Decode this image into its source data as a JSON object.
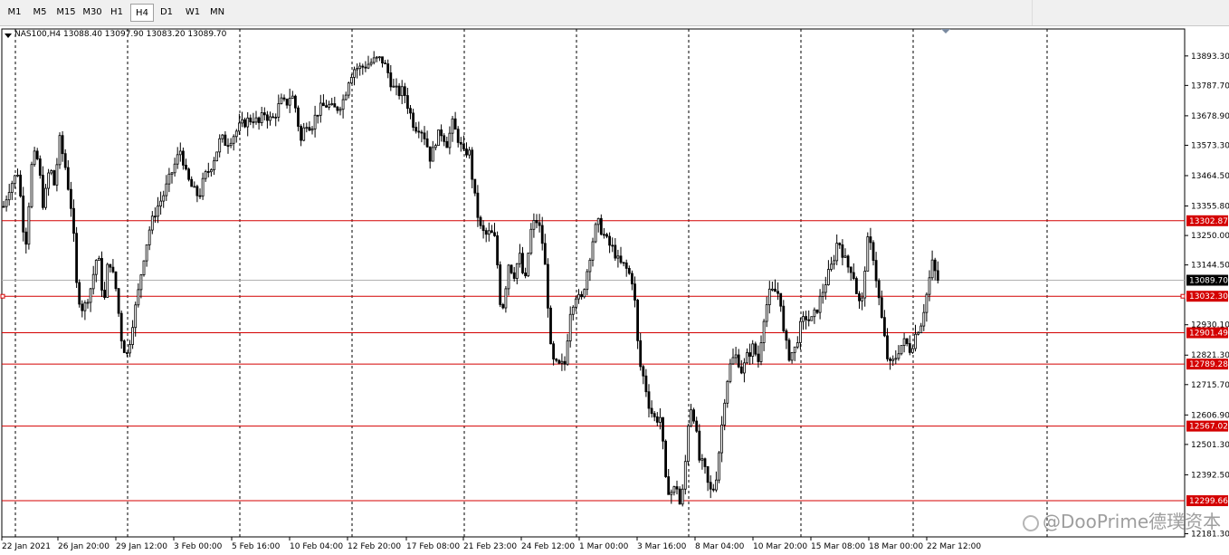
{
  "toolbar": {
    "timeframes": [
      {
        "label": "M1",
        "active": false
      },
      {
        "label": "M5",
        "active": false
      },
      {
        "label": "M15",
        "active": false
      },
      {
        "label": "M30",
        "active": false
      },
      {
        "label": "H1",
        "active": false
      },
      {
        "label": "H4",
        "active": true
      },
      {
        "label": "D1",
        "active": false
      },
      {
        "label": "W1",
        "active": false
      },
      {
        "label": "MN",
        "active": false
      }
    ]
  },
  "symbol_info": "NAS100,H4  13088.40 13097.90 13083.20 13089.70",
  "watermark": {
    "text": "@DooPrime德璞资本",
    "icon": "wechat-icon"
  },
  "colors": {
    "level_line": "#d40000",
    "candle": "#000000",
    "grid": "#000000",
    "current_price_bg": "#000000"
  },
  "chart_data": {
    "type": "candlestick",
    "symbol": "NAS100",
    "timeframe": "H4",
    "ohlc_header": {
      "open": 13088.4,
      "high": 13097.9,
      "low": 13083.2,
      "close": 13089.7
    },
    "y_ticks": [
      13893.3,
      13787.7,
      13678.9,
      13573.3,
      13464.5,
      13355.8,
      13250.0,
      13144.5,
      12930.1,
      12821.3,
      12715.7,
      12606.9,
      12501.3,
      12392.5,
      12181.3
    ],
    "ylim": [
      12170.0,
      13990.0
    ],
    "x_ticks": [
      "22 Jan 2021",
      "26 Jan 20:00",
      "29 Jan 12:00",
      "3 Feb 00:00",
      "5 Feb 16:00",
      "10 Feb 04:00",
      "12 Feb 20:00",
      "17 Feb 08:00",
      "21 Feb 23:00",
      "24 Feb 12:00",
      "1 Mar 00:00",
      "3 Mar 16:00",
      "8 Mar 04:00",
      "10 Mar 20:00",
      "15 Mar 08:00",
      "18 Mar 00:00",
      "22 Mar 12:00"
    ],
    "levels": [
      13302.87,
      13032.3,
      12901.49,
      12789.28,
      12567.02,
      12299.66
    ],
    "level_labels": [
      "13302.87",
      "13032.30",
      "12901.49",
      "12789.28",
      "12567.02",
      "12299.66"
    ],
    "current_price": 13089.7,
    "current_price_label": "13089.70",
    "trend_points": [
      [
        0,
        13310
      ],
      [
        10,
        13420
      ],
      [
        20,
        13480
      ],
      [
        28,
        13200
      ],
      [
        36,
        13540
      ],
      [
        42,
        13520
      ],
      [
        48,
        13350
      ],
      [
        55,
        13500
      ],
      [
        60,
        13430
      ],
      [
        66,
        13590
      ],
      [
        72,
        13500
      ],
      [
        80,
        13320
      ],
      [
        85,
        13050
      ],
      [
        92,
        12980
      ],
      [
        100,
        13060
      ],
      [
        108,
        13190
      ],
      [
        115,
        13000
      ],
      [
        120,
        13180
      ],
      [
        128,
        13060
      ],
      [
        135,
        12860
      ],
      [
        141,
        12820
      ],
      [
        146,
        12930
      ],
      [
        152,
        13030
      ],
      [
        158,
        13160
      ],
      [
        165,
        13270
      ],
      [
        172,
        13340
      ],
      [
        180,
        13390
      ],
      [
        188,
        13460
      ],
      [
        195,
        13520
      ],
      [
        200,
        13560
      ],
      [
        206,
        13460
      ],
      [
        214,
        13410
      ],
      [
        220,
        13390
      ],
      [
        226,
        13460
      ],
      [
        232,
        13490
      ],
      [
        238,
        13540
      ],
      [
        244,
        13600
      ],
      [
        250,
        13580
      ],
      [
        258,
        13610
      ],
      [
        265,
        13640
      ],
      [
        272,
        13660
      ],
      [
        280,
        13670
      ],
      [
        286,
        13650
      ],
      [
        292,
        13690
      ],
      [
        300,
        13660
      ],
      [
        305,
        13690
      ],
      [
        310,
        13730
      ],
      [
        316,
        13720
      ],
      [
        322,
        13760
      ],
      [
        328,
        13690
      ],
      [
        332,
        13580
      ],
      [
        338,
        13660
      ],
      [
        344,
        13640
      ],
      [
        350,
        13690
      ],
      [
        356,
        13710
      ],
      [
        362,
        13720
      ],
      [
        368,
        13700
      ],
      [
        374,
        13710
      ],
      [
        380,
        13740
      ],
      [
        386,
        13820
      ],
      [
        392,
        13850
      ],
      [
        398,
        13850
      ],
      [
        404,
        13860
      ],
      [
        410,
        13870
      ],
      [
        416,
        13880
      ],
      [
        422,
        13880
      ],
      [
        428,
        13840
      ],
      [
        434,
        13780
      ],
      [
        440,
        13760
      ],
      [
        446,
        13770
      ],
      [
        452,
        13700
      ],
      [
        458,
        13640
      ],
      [
        464,
        13640
      ],
      [
        470,
        13600
      ],
      [
        476,
        13520
      ],
      [
        482,
        13600
      ],
      [
        488,
        13620
      ],
      [
        494,
        13580
      ],
      [
        500,
        13650
      ],
      [
        506,
        13600
      ],
      [
        512,
        13540
      ],
      [
        518,
        13560
      ],
      [
        524,
        13400
      ],
      [
        530,
        13280
      ],
      [
        536,
        13250
      ],
      [
        542,
        13260
      ],
      [
        548,
        13230
      ],
      [
        552,
        13020
      ],
      [
        556,
        13000
      ],
      [
        562,
        13150
      ],
      [
        568,
        13110
      ],
      [
        574,
        13180
      ],
      [
        580,
        13070
      ],
      [
        586,
        13260
      ],
      [
        592,
        13310
      ],
      [
        598,
        13260
      ],
      [
        604,
        13090
      ],
      [
        608,
        12850
      ],
      [
        612,
        12790
      ],
      [
        618,
        12780
      ],
      [
        624,
        12790
      ],
      [
        630,
        12980
      ],
      [
        636,
        13040
      ],
      [
        642,
        13010
      ],
      [
        648,
        13110
      ],
      [
        654,
        13220
      ],
      [
        660,
        13300
      ],
      [
        666,
        13260
      ],
      [
        672,
        13220
      ],
      [
        678,
        13200
      ],
      [
        684,
        13150
      ],
      [
        690,
        13140
      ],
      [
        694,
        13120
      ],
      [
        700,
        13080
      ],
      [
        706,
        12800
      ],
      [
        712,
        12730
      ],
      [
        718,
        12630
      ],
      [
        724,
        12590
      ],
      [
        730,
        12600
      ],
      [
        736,
        12350
      ],
      [
        742,
        12330
      ],
      [
        748,
        12350
      ],
      [
        752,
        12270
      ],
      [
        756,
        12380
      ],
      [
        762,
        12650
      ],
      [
        768,
        12590
      ],
      [
        772,
        12450
      ],
      [
        778,
        12420
      ],
      [
        784,
        12330
      ],
      [
        790,
        12350
      ],
      [
        796,
        12520
      ],
      [
        802,
        12710
      ],
      [
        808,
        12800
      ],
      [
        814,
        12820
      ],
      [
        820,
        12760
      ],
      [
        826,
        12820
      ],
      [
        832,
        12850
      ],
      [
        838,
        12800
      ],
      [
        844,
        12960
      ],
      [
        850,
        13040
      ],
      [
        856,
        13050
      ],
      [
        862,
        13040
      ],
      [
        866,
        12890
      ],
      [
        872,
        12820
      ],
      [
        878,
        12840
      ],
      [
        884,
        12920
      ],
      [
        890,
        12960
      ],
      [
        896,
        12940
      ],
      [
        902,
        12980
      ],
      [
        908,
        13040
      ],
      [
        914,
        13100
      ],
      [
        920,
        13150
      ],
      [
        926,
        13240
      ],
      [
        930,
        13200
      ],
      [
        936,
        13140
      ],
      [
        942,
        13130
      ],
      [
        948,
        13020
      ],
      [
        952,
        12990
      ],
      [
        958,
        13230
      ],
      [
        964,
        13200
      ],
      [
        970,
        13050
      ],
      [
        976,
        12910
      ],
      [
        982,
        12780
      ],
      [
        988,
        12800
      ],
      [
        994,
        12850
      ],
      [
        1000,
        12870
      ],
      [
        1006,
        12840
      ],
      [
        1012,
        12900
      ],
      [
        1018,
        12940
      ],
      [
        1024,
        13040
      ],
      [
        1030,
        13150
      ],
      [
        1034,
        13110
      ],
      [
        1038,
        13089.7
      ]
    ]
  }
}
